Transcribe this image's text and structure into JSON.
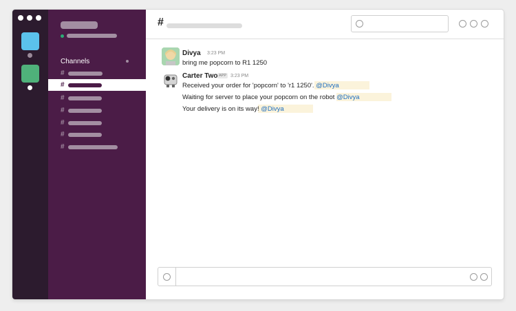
{
  "channel_header": {
    "hash": "#"
  },
  "sidebar": {
    "channels_title": "Channels"
  },
  "channel_hash": "#",
  "messages": [
    {
      "author": "Divya",
      "time": "3:23 PM",
      "lines": [
        {
          "text": "bring me popcorn to R1 1250",
          "mention": ""
        }
      ]
    },
    {
      "author": "Carter Two",
      "badge": "APP",
      "time": "3:23 PM",
      "lines": [
        {
          "text": "Received your order for 'popcorn' to 'r1 1250'.",
          "mention": "@Divya"
        },
        {
          "text": "Waiting for server to place your popcorn on the robot",
          "mention": "@Divya"
        },
        {
          "text": "Your delivery is on its way!",
          "mention": "@Divya"
        }
      ]
    }
  ],
  "colors": {
    "rail": "#2c1b2e",
    "sidebar": "#4b1c47",
    "workspace_blue": "#5bc2ec",
    "workspace_green": "#4fb17a",
    "highlight": "#fbf3db"
  },
  "icons": [
    "window-control-icon",
    "search-icon",
    "header-action-icon",
    "composer-attach-icon",
    "emoji-icon"
  ]
}
